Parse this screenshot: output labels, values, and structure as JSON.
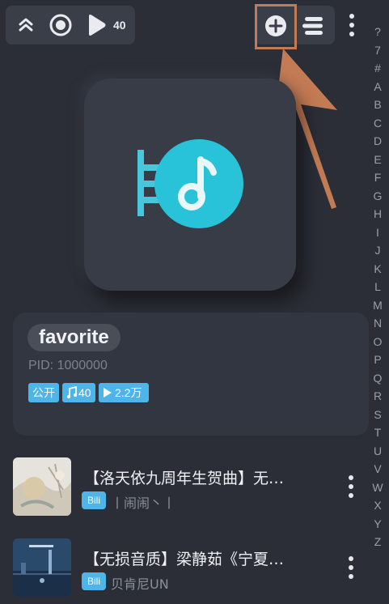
{
  "toolbar": {
    "collapse_icon": "double-chevron-up-icon",
    "record_icon": "radio-button-icon",
    "play_icon": "play-icon",
    "track_count": "40",
    "add_icon": "plus-circle-icon",
    "sort_icon": "stacked-lines-icon",
    "more_icon": "vertical-dots-icon"
  },
  "alphabet_index": [
    "?",
    "7",
    "#",
    "A",
    "B",
    "C",
    "D",
    "E",
    "F",
    "G",
    "H",
    "I",
    "J",
    "K",
    "L",
    "M",
    "N",
    "O",
    "P",
    "Q",
    "R",
    "S",
    "T",
    "U",
    "V",
    "W",
    "X",
    "Y",
    "Z"
  ],
  "playlist": {
    "cover_icon": "music-note-icon",
    "name": "favorite",
    "pid": "PID: 1000000",
    "tags": [
      {
        "label": "公开"
      },
      {
        "label": "40",
        "icon": "music-note-icon"
      },
      {
        "label": "2.2万",
        "icon": "play-icon"
      }
    ]
  },
  "songs": [
    {
      "title": "【洛天依九周年生贺曲】无…",
      "source_badge": "Bili",
      "artist": "丨闹闹丶丨"
    },
    {
      "title": "【无损音质】梁静茹《宁夏…",
      "source_badge": "Bili",
      "artist": "贝肯尼UN"
    }
  ],
  "colors": {
    "background": "#2b2e36",
    "panel": "#3a3e48",
    "accent": "#29c3d9",
    "tag_blue": "#4fb4e8",
    "highlight": "#c37b54"
  }
}
